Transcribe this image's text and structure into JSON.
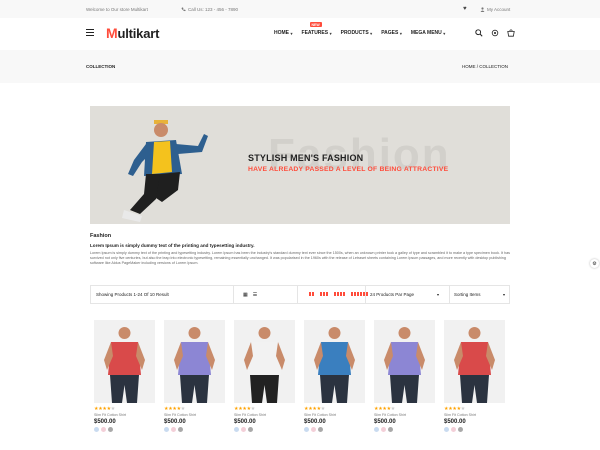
{
  "topbar": {
    "welcome": "Welcome to Our store Multikart",
    "phone": "Call Us: 123 - 456 - 7890",
    "account": "My Account"
  },
  "header": {
    "logo_initial": "M",
    "logo_rest": "ultikart",
    "nav": [
      {
        "label": "HOME"
      },
      {
        "label": "FEATURES",
        "badge": "NEW"
      },
      {
        "label": "PRODUCTS"
      },
      {
        "label": "PAGES"
      },
      {
        "label": "MEGA MENU"
      }
    ],
    "icons": [
      "search-icon",
      "settings-icon",
      "cart-icon"
    ]
  },
  "breadcrumb": {
    "title": "COLLECTION",
    "path": "HOME / COLLECTION"
  },
  "banner": {
    "bg_word": "Fashion",
    "heading": "STYLISH MEN'S FASHION",
    "subheading": "HAVE ALREADY PASSED A LEVEL OF BEING ATTRACTIVE"
  },
  "description": {
    "title": "Fashion",
    "lead": "Lorem Ipsum is simply dummy text of the printing and typesetting industry.",
    "body": "Lorem Ipsum is simply dummy text of the printing and typesetting industry. Lorem Ipsum has been the industry's standard dummy text ever since the 1500s, when an unknown printer took a galley of type and scrambled it to make a type specimen book. It has survived not only five centuries, but also the leap into electronic typesetting, remaining essentially unchanged. It was popularised in the 1960s with the release of Letraset sheets containing Lorem Ipsum passages, and more recently with desktop publishing software like Aldus PageMaker including versions of Lorem Ipsum."
  },
  "toolbar": {
    "count": "Showing Products 1-24 Of 10 Result",
    "per_page": "24 Products Par Page",
    "sort": "Sorting Items"
  },
  "products": [
    {
      "name": "Slim Fit Cotton Shirt",
      "price": "$500.00",
      "rating": 4,
      "shirt": "#d94a4a"
    },
    {
      "name": "Slim Fit Cotton Shirt",
      "price": "$500.00",
      "rating": 4,
      "shirt": "#8c86d4"
    },
    {
      "name": "Slim Fit Cotton Shirt",
      "price": "$500.00",
      "rating": 4,
      "shirt": "#f2f2f2"
    },
    {
      "name": "Slim Fit Cotton Shirt",
      "price": "$500.00",
      "rating": 4,
      "shirt": "#3a7fbf"
    },
    {
      "name": "Slim Fit Cotton Shirt",
      "price": "$500.00",
      "rating": 4,
      "shirt": "#8c86d4"
    },
    {
      "name": "Slim Fit Cotton Shirt",
      "price": "$500.00",
      "rating": 4,
      "shirt": "#d94a4a"
    }
  ],
  "swatch_colors": [
    "#c9dbf0",
    "#f3cfd8",
    "#a9a9a9"
  ],
  "colors": {
    "accent": "#ff4c3b",
    "star": "#ffa200"
  }
}
